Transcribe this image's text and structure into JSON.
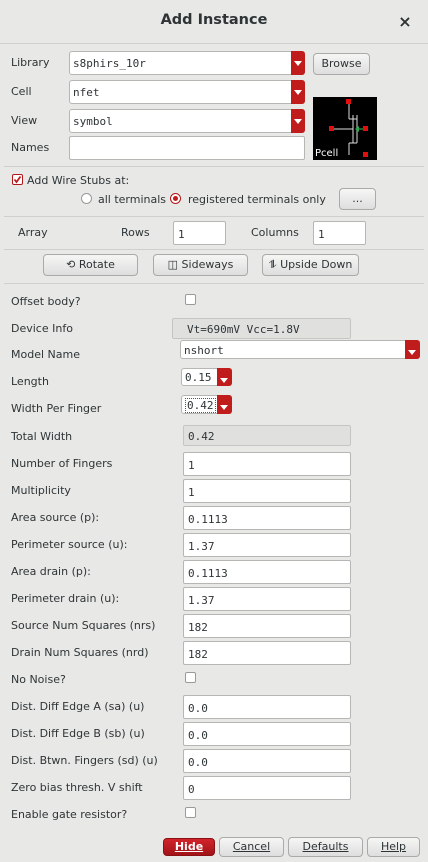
{
  "window": {
    "title": "Add Instance",
    "close_label": "×"
  },
  "form": {
    "library_label": "Library",
    "library_value": "s8phirs_10r",
    "browse_label": "Browse",
    "cell_label": "Cell",
    "cell_value": "nfet",
    "view_label": "View",
    "view_value": "symbol",
    "names_label": "Names",
    "names_value": "",
    "preview_caption": "Pcell"
  },
  "stubs": {
    "label": "Add Wire Stubs at:",
    "checked": true,
    "opt_all": "all terminals",
    "opt_registered": "registered terminals only",
    "more_label": "..."
  },
  "array": {
    "label": "Array",
    "rows_label": "Rows",
    "rows_value": "1",
    "columns_label": "Columns",
    "columns_value": "1"
  },
  "actions": {
    "rotate": "Rotate",
    "sideways": "Sideways",
    "upside_down": "Upside Down"
  },
  "params": {
    "offset_body": "Offset body?",
    "device_info_label": "Device Info",
    "device_info_value": "Vt=690mV  Vcc=1.8V",
    "model_name_label": "Model Name",
    "model_name_value": "nshort",
    "length_label": "Length",
    "length_value": "0.15",
    "wpf_label": "Width Per Finger",
    "wpf_value": "0.42",
    "total_width_label": "Total Width",
    "total_width_value": "0.42",
    "fingers_label": "Number of Fingers",
    "fingers_value": "1",
    "mult_label": "Multiplicity",
    "mult_value": "1",
    "as_label": "Area source (p):",
    "as_value": "0.1113",
    "ps_label": "Perimeter source (u):",
    "ps_value": "1.37",
    "ad_label": "Area drain (p):",
    "ad_value": "0.1113",
    "pd_label": "Perimeter drain (u):",
    "pd_value": "1.37",
    "nrs_label": "Source Num Squares (nrs)",
    "nrs_value": "182",
    "nrd_label": "Drain Num Squares (nrd)",
    "nrd_value": "182",
    "no_noise": "No Noise?",
    "sa_label": "Dist. Diff Edge A (sa) (u)",
    "sa_value": "0.0",
    "sb_label": "Dist. Diff Edge B (sb) (u)",
    "sb_value": "0.0",
    "sd_label": "Dist. Btwn. Fingers (sd) (u)",
    "sd_value": "0.0",
    "vshift_label": "Zero bias thresh. V shift",
    "vshift_value": "0",
    "gate_res": "Enable gate resistor?"
  },
  "footer": {
    "hide": "Hide",
    "cancel": "Cancel",
    "defaults": "Defaults",
    "help": "Help"
  },
  "colors": {
    "accent": "#c11c1c",
    "background": "#e8e8e7"
  }
}
